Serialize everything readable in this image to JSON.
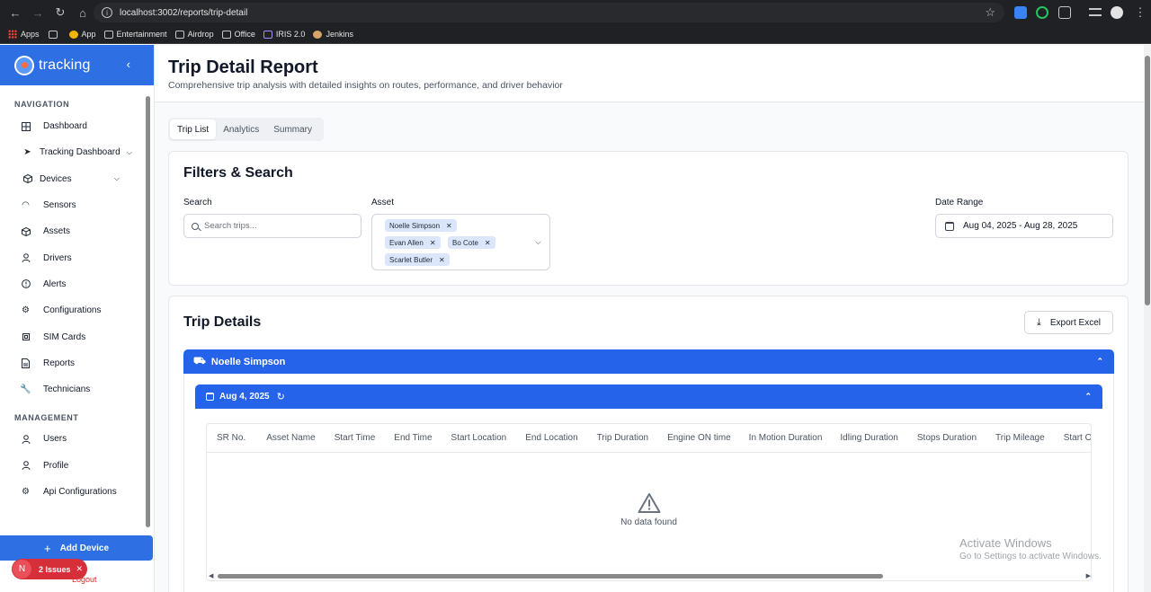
{
  "browser": {
    "url": "localhost:3002/reports/trip-detail",
    "bookmarks": [
      "Apps",
      "App",
      "Entertainment",
      "Airdrop",
      "Office",
      "IRIS 2.0",
      "Jenkins"
    ]
  },
  "sidebar": {
    "brand": "tracking",
    "sections": [
      {
        "title": "NAVIGATION",
        "items": [
          {
            "label": "Dashboard",
            "icon": "grid-icon"
          },
          {
            "label": "Tracking Dashboard",
            "icon": "navigation-icon",
            "expandable": true
          },
          {
            "label": "Devices",
            "icon": "box-icon",
            "expandable": true
          },
          {
            "label": "Sensors",
            "icon": "gauge-icon"
          },
          {
            "label": "Assets",
            "icon": "package-icon"
          },
          {
            "label": "Drivers",
            "icon": "user-icon"
          },
          {
            "label": "Alerts",
            "icon": "alert-circle-icon"
          },
          {
            "label": "Configurations",
            "icon": "settings-icon"
          },
          {
            "label": "SIM Cards",
            "icon": "cpu-icon"
          },
          {
            "label": "Reports",
            "icon": "file-icon"
          },
          {
            "label": "Technicians",
            "icon": "wrench-icon"
          }
        ]
      },
      {
        "title": "MANAGEMENT",
        "items": [
          {
            "label": "Users",
            "icon": "users-icon"
          },
          {
            "label": "Profile",
            "icon": "user-icon"
          },
          {
            "label": "Api Configurations",
            "icon": "settings-icon"
          }
        ]
      }
    ],
    "add_device": "Add Device",
    "issues_badge": {
      "initial": "N",
      "label": "2 Issues"
    },
    "logout": "Logout"
  },
  "page": {
    "title": "Trip Detail Report",
    "subtitle": "Comprehensive trip analysis with detailed insights on routes, performance, and driver behavior",
    "tabs": [
      {
        "label": "Trip List",
        "active": true
      },
      {
        "label": "Analytics",
        "active": false
      },
      {
        "label": "Summary",
        "active": false
      }
    ]
  },
  "filters": {
    "title": "Filters & Search",
    "search_label": "Search",
    "search_placeholder": "Search trips...",
    "asset_label": "Asset",
    "assets_selected": [
      "Noelle Simpson",
      "Evan Allen",
      "Bo Cote",
      "Scarlet Butler"
    ],
    "date_label": "Date Range",
    "date_value": "Aug 04, 2025 - Aug 28, 2025"
  },
  "details": {
    "title": "Trip Details",
    "export_label": "Export Excel",
    "group_name": "Noelle Simpson",
    "date_group": "Aug 4, 2025",
    "columns": [
      "SR No.",
      "Asset Name",
      "Start Time",
      "End Time",
      "Start Location",
      "End Location",
      "Trip Duration",
      "Engine ON time",
      "In Motion Duration",
      "Idling Duration",
      "Stops Duration",
      "Trip Mileage",
      "Start O"
    ],
    "empty_text": "No data found"
  },
  "watermark": {
    "line1": "Activate Windows",
    "line2": "Go to Settings to activate Windows."
  },
  "colors": {
    "primary": "#2563eb",
    "brand": "#2f6fe4",
    "danger": "#d72f3a"
  }
}
